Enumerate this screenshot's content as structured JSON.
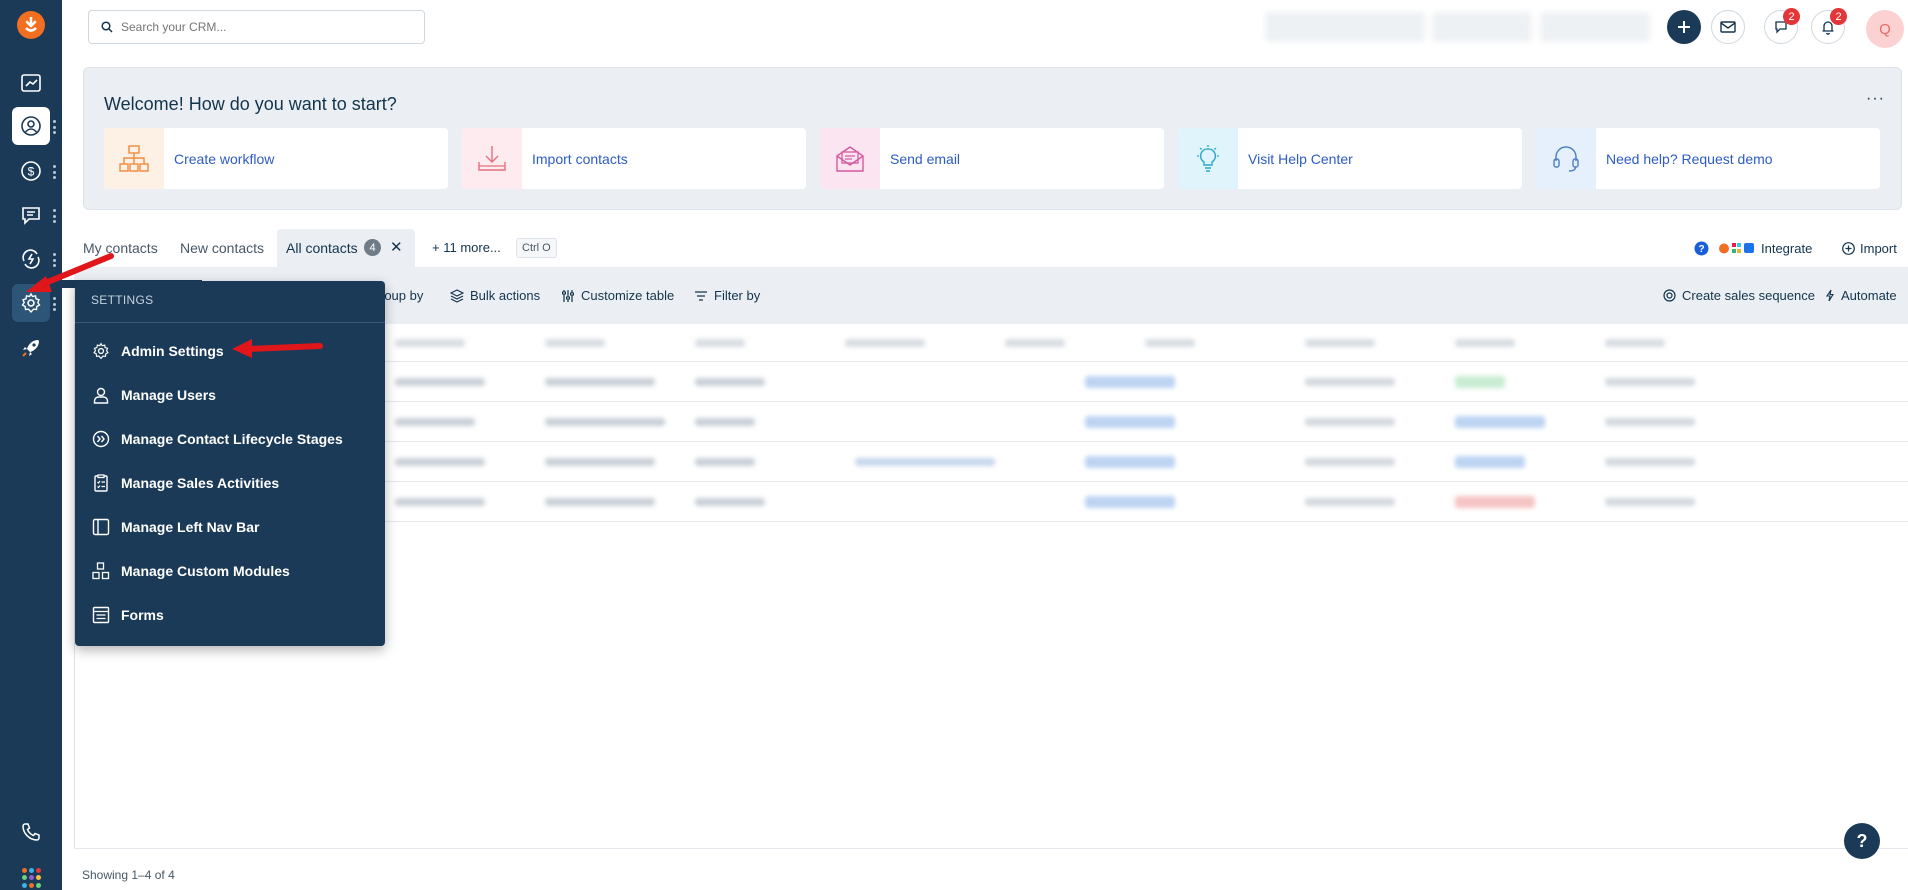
{
  "search": {
    "placeholder": "Search your CRM..."
  },
  "header": {
    "chat_badge": "2",
    "notif_badge": "2",
    "avatar_initial": "Q"
  },
  "welcome": {
    "title": "Welcome! How do you want to start?",
    "more": "···",
    "cards": [
      {
        "label": "Create workflow",
        "icon": "workflow-icon",
        "bg": "#fdf1e6"
      },
      {
        "label": "Import contacts",
        "icon": "import-icon",
        "bg": "#fdebef"
      },
      {
        "label": "Send email",
        "icon": "email-icon",
        "bg": "#fbe5f1"
      },
      {
        "label": "Visit Help Center",
        "icon": "lightbulb-icon",
        "bg": "#e0f5fb"
      },
      {
        "label": "Need help? Request demo",
        "icon": "headset-icon",
        "bg": "#e5f0fc"
      }
    ]
  },
  "tabs": {
    "my_contacts": "My contacts",
    "new_contacts": "New contacts",
    "all_contacts": "All contacts",
    "all_contacts_count": "4",
    "more": "11 more...",
    "shortcut": "Ctrl O",
    "integrate": "Integrate",
    "import": "Import"
  },
  "toolbar": {
    "group_by": "roup by",
    "bulk_actions": "Bulk actions",
    "customize_table": "Customize table",
    "filter_by": "Filter by",
    "create_sales_sequence": "Create sales sequence",
    "automate": "Automate"
  },
  "settings_menu": {
    "header": "SETTINGS",
    "items": [
      {
        "label": "Admin Settings",
        "icon": "gear-icon"
      },
      {
        "label": "Manage Users",
        "icon": "user-icon"
      },
      {
        "label": "Manage Contact Lifecycle Stages",
        "icon": "lifecycle-icon"
      },
      {
        "label": "Manage Sales Activities",
        "icon": "checklist-icon"
      },
      {
        "label": "Manage Left Nav Bar",
        "icon": "sidebar-layout-icon"
      },
      {
        "label": "Manage Custom Modules",
        "icon": "modules-icon"
      },
      {
        "label": "Forms",
        "icon": "forms-icon"
      }
    ]
  },
  "footer": {
    "showing": "Showing 1–4 of 4"
  },
  "help_fab": "?",
  "colors": {
    "nav_bg": "#1b3a57",
    "accent_blue": "#2c5cc5",
    "badge_red": "#e43538",
    "annotation_red": "#e0161b"
  }
}
